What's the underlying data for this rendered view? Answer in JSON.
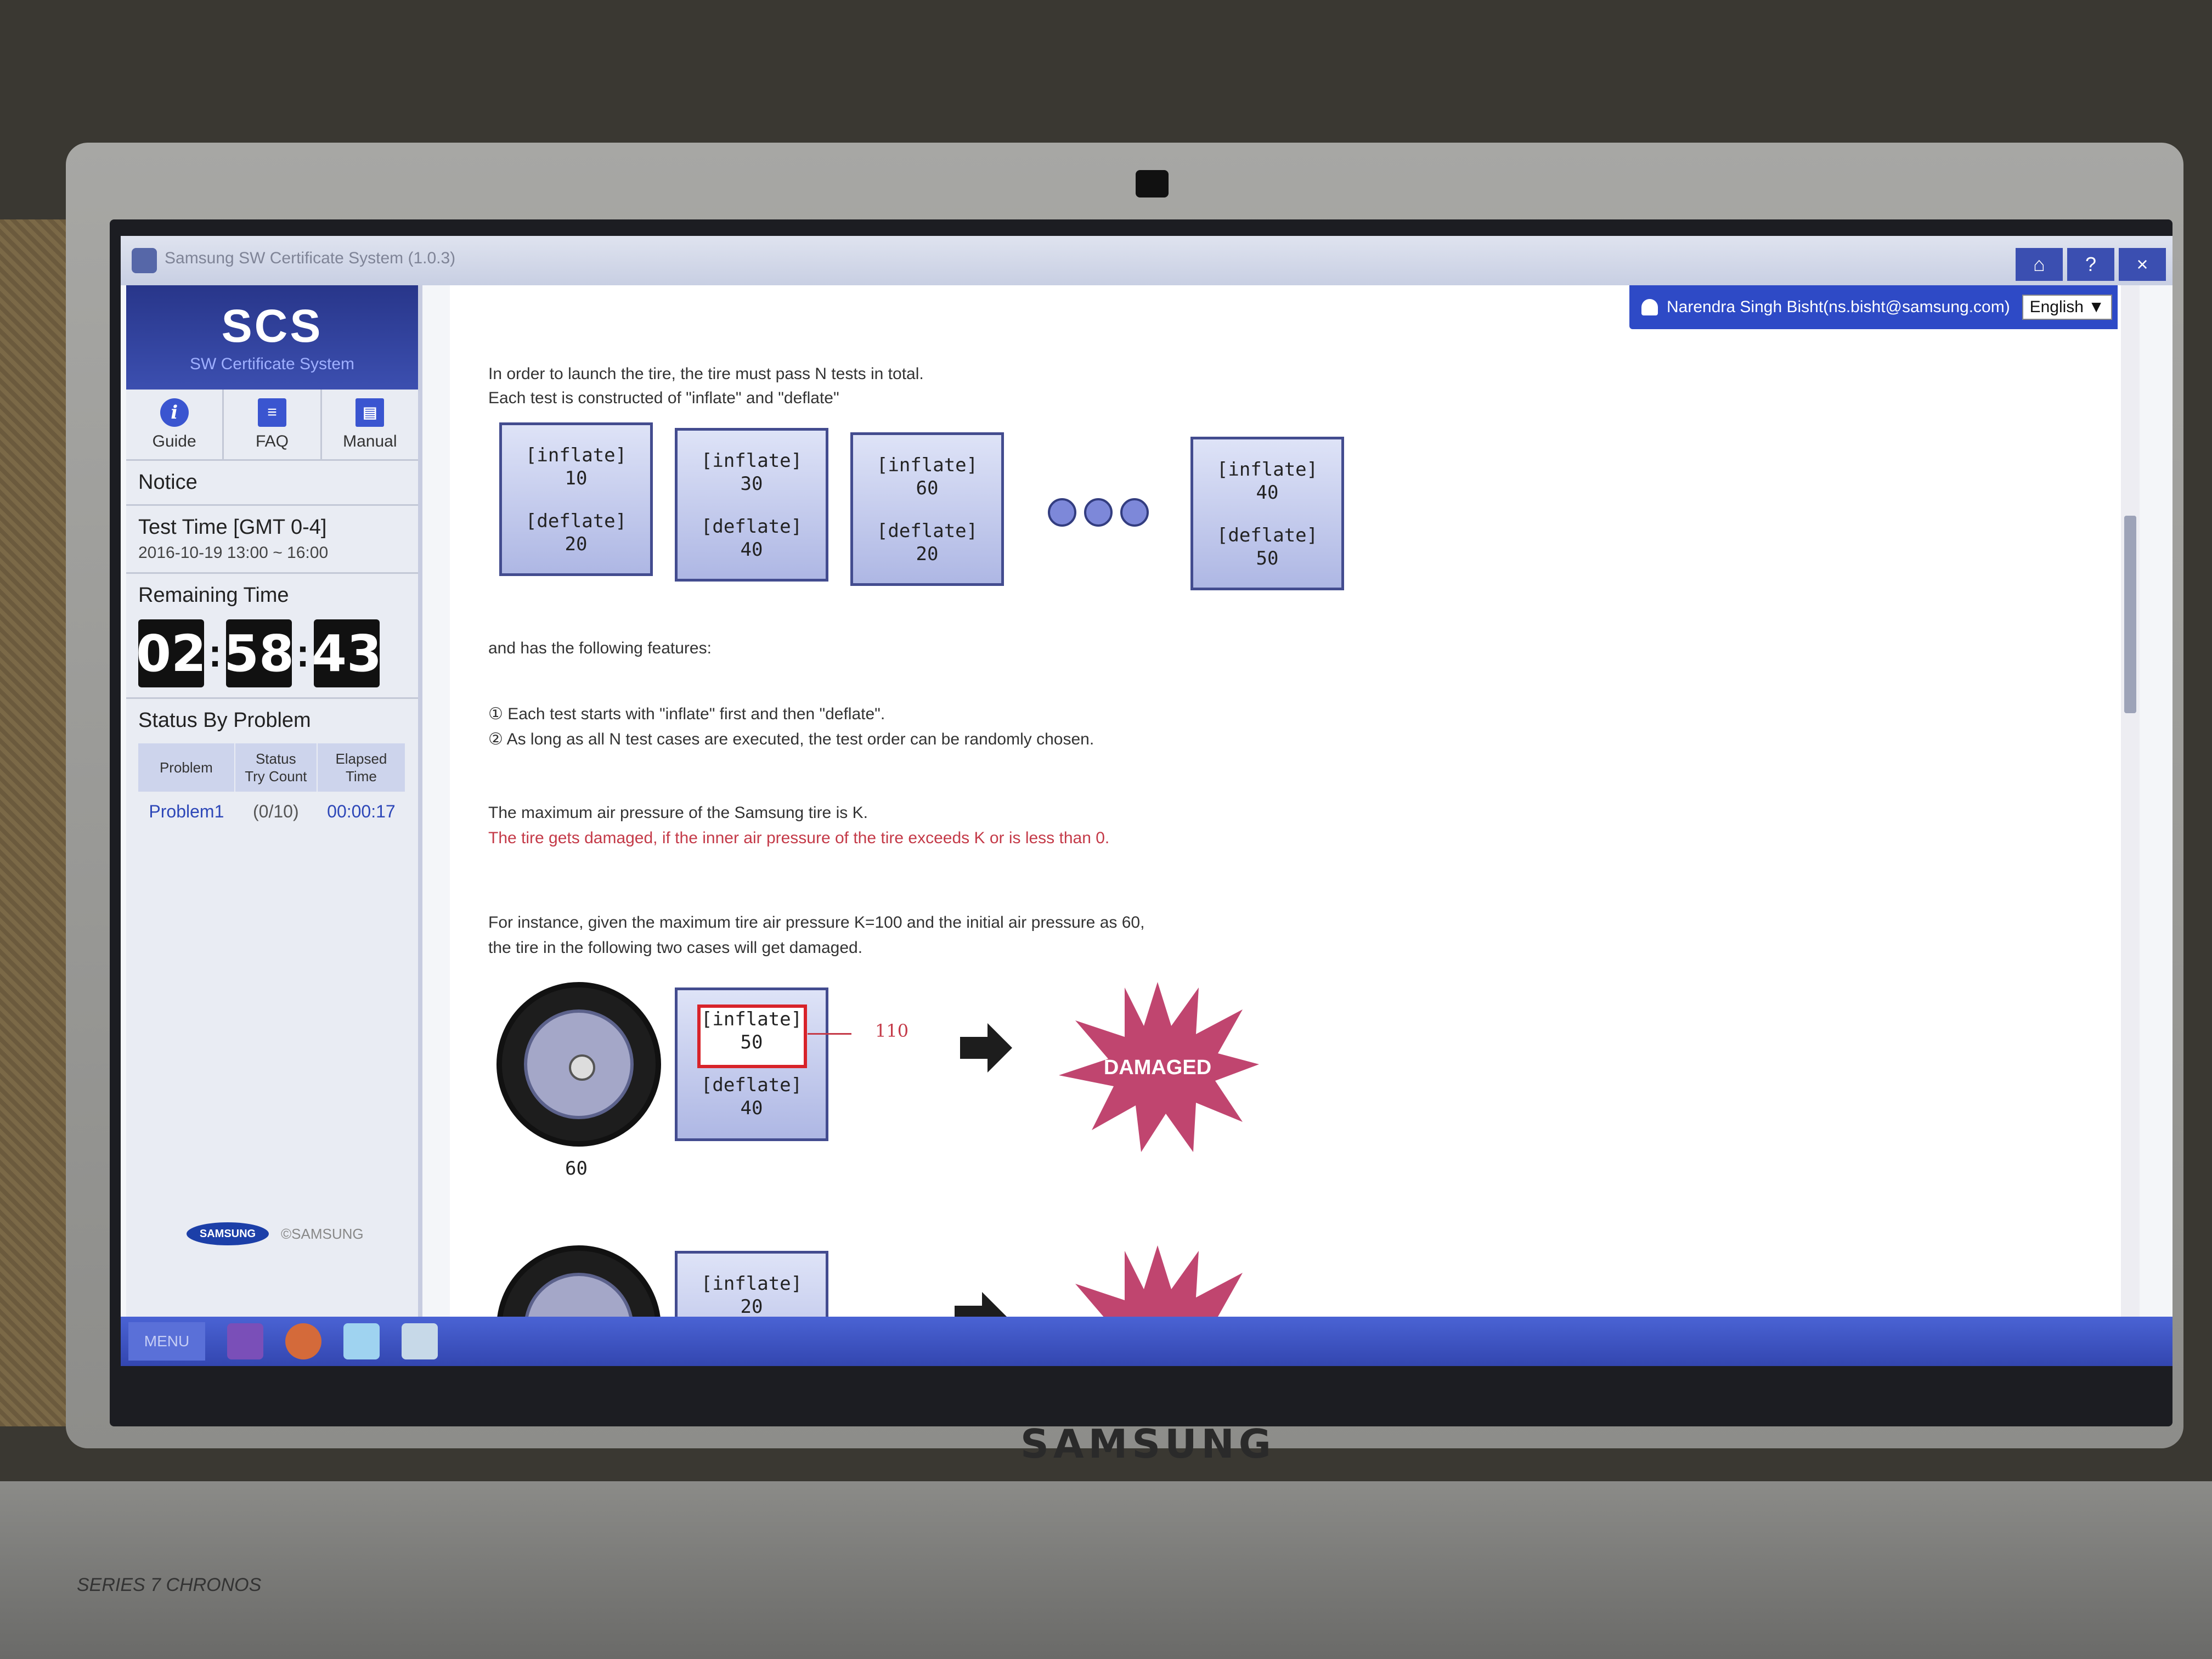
{
  "window": {
    "title": "Samsung SW Certificate System (1.0.3)",
    "buttons": [
      "⌂",
      "?",
      "×"
    ]
  },
  "sidebar": {
    "logo": "SCS",
    "logo_sub": "SW Certificate System",
    "nav": [
      {
        "label": "Guide",
        "icon": "info-icon"
      },
      {
        "label": "FAQ",
        "icon": "list-icon"
      },
      {
        "label": "Manual",
        "icon": "book-icon"
      }
    ],
    "notice": "Notice",
    "test_time_title": "Test Time [GMT 0-4]",
    "test_time_value": "2016-10-19 13:00 ~ 16:00",
    "remaining_title": "Remaining Time",
    "timer": {
      "h": "02",
      "m": "58",
      "s": "43"
    },
    "status_title": "Status By Problem",
    "table_headers": [
      "Problem",
      "Status\nTry Count",
      "Elapsed\nTime"
    ],
    "rows": [
      {
        "problem": "Problem1",
        "status": "(0/10)",
        "elapsed": "00:00:17"
      }
    ],
    "footer_brand": "SAMSUNG",
    "footer_copy": "©SAMSUNG"
  },
  "userbar": {
    "user": "Narendra Singh Bisht(ns.bisht@samsung.com)",
    "language": "English ▼"
  },
  "content": {
    "intro1": "In order to launch the tire, the tire must pass N tests in total.",
    "intro2": "Each test is constructed of \"inflate\" and \"deflate\"",
    "tests": [
      {
        "inflate_label": "[inflate]",
        "inflate": "10",
        "deflate_label": "[deflate]",
        "deflate": "20"
      },
      {
        "inflate_label": "[inflate]",
        "inflate": "30",
        "deflate_label": "[deflate]",
        "deflate": "40"
      },
      {
        "inflate_label": "[inflate]",
        "inflate": "60",
        "deflate_label": "[deflate]",
        "deflate": "20"
      },
      {
        "inflate_label": "[inflate]",
        "inflate": "40",
        "deflate_label": "[deflate]",
        "deflate": "50"
      }
    ],
    "features_intro": "and has the following features:",
    "feature1": "① Each test starts with \"inflate\" first and then \"deflate\".",
    "feature2": "② As long as all N test cases are executed, the test order can be randomly chosen.",
    "max_pressure": "The maximum air pressure of the Samsung tire is K.",
    "damage_rule": "The tire gets damaged, if the inner air pressure of the tire exceeds K or is less than 0.",
    "instance1": "For instance, given the maximum tire air pressure K=100 and the initial air pressure as 60,",
    "instance2": "the tire in the following two cases will get damaged.",
    "example1": {
      "tire_value": "60",
      "inflate_label": "[inflate]",
      "inflate": "50",
      "deflate_label": "[deflate]",
      "deflate": "40",
      "result_value": "110",
      "damaged": "DAMAGED"
    },
    "example2": {
      "inflate_label": "[inflate]",
      "inflate": "20"
    }
  },
  "taskbar": {
    "menu": "MENU"
  },
  "laptop_brand": "SAMSUNG",
  "laptop_model": "SERIES 7 CHRONOS",
  "colors": {
    "accent": "#2e4ac6",
    "test_box_border": "#434c8f",
    "damage": "#c0456f",
    "warning_text": "#c43a48"
  }
}
